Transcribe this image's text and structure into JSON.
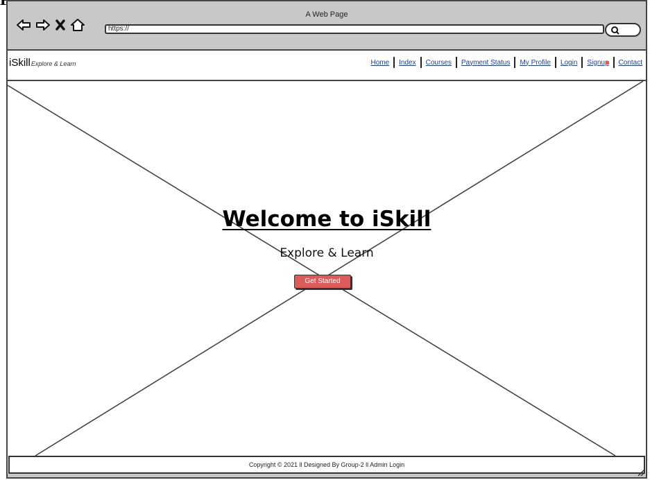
{
  "window": {
    "title": "A Web Page"
  },
  "browser": {
    "url": "https://",
    "icons": [
      "back-arrow-icon",
      "forward-arrow-icon",
      "close-x-icon",
      "home-icon",
      "search-icon"
    ]
  },
  "header": {
    "brand_name": "iSkill",
    "brand_tagline": "Explore & Learn",
    "nav": [
      {
        "label": "Home"
      },
      {
        "label": "Index"
      },
      {
        "label": "Courses"
      },
      {
        "label": "Payment Status"
      },
      {
        "label": "My Profile"
      },
      {
        "label": "Login"
      },
      {
        "label": "Signup"
      },
      {
        "label": "Contact"
      }
    ]
  },
  "hero": {
    "title": "Welcome to iSkill",
    "subtitle": "Explore & Learn",
    "cta_label": "Get Started"
  },
  "footer": {
    "text": "Copyright © 2021 ll Designed By Group-2 ll Admin Login"
  },
  "colors": {
    "chrome": "#c8c8c8",
    "link": "#1e3f8a",
    "cta": "#db5b5b"
  }
}
